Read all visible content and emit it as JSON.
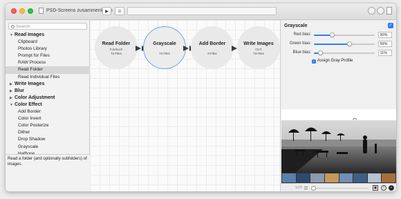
{
  "window": {
    "title": "PSD-Screens zusammenlegen"
  },
  "toolbar": {
    "play_icon": "play-icon",
    "play_glyph": "▶",
    "grid_icon": "grid-icon",
    "grid_glyph": "⊞",
    "search_field_value": "",
    "right_buttons": [
      "circle-button",
      "circle-button",
      "document-icon"
    ]
  },
  "sidebar": {
    "search_placeholder": "Search",
    "tree": [
      {
        "kind": "category",
        "label": "Read Images",
        "expanded": true
      },
      {
        "kind": "item",
        "label": "Clipboard"
      },
      {
        "kind": "item",
        "label": "Photos Library"
      },
      {
        "kind": "item",
        "label": "Prompt for Files"
      },
      {
        "kind": "item",
        "label": "RAW Process"
      },
      {
        "kind": "item",
        "label": "Read Folder",
        "selected": true
      },
      {
        "kind": "item",
        "label": "Read Individual Files"
      },
      {
        "kind": "category",
        "label": "Write Images",
        "expanded": false
      },
      {
        "kind": "category",
        "label": "Blur",
        "expanded": false
      },
      {
        "kind": "category",
        "label": "Color Adjustment",
        "expanded": false
      },
      {
        "kind": "category",
        "label": "Color Effect",
        "expanded": true
      },
      {
        "kind": "item",
        "label": "Add Border"
      },
      {
        "kind": "item",
        "label": "Color Invert"
      },
      {
        "kind": "item",
        "label": "Color Posterize"
      },
      {
        "kind": "item",
        "label": "Dither"
      },
      {
        "kind": "item",
        "label": "Drop Shadow"
      },
      {
        "kind": "item",
        "label": "Grayscale"
      },
      {
        "kind": "item",
        "label": "Halftone"
      }
    ],
    "description": "Read a folder (and optionally subfolders) of images."
  },
  "workflow": {
    "nodes": [
      {
        "title": "Read Folder",
        "subtitle": "Fotobuch",
        "files": "73 Files",
        "selected": false
      },
      {
        "title": "Grayscale",
        "subtitle": "",
        "files": "73 Files",
        "selected": true
      },
      {
        "title": "Add Border",
        "subtitle": "",
        "files": "0 Files",
        "selected": false
      },
      {
        "title": "Write Images",
        "subtitle": "OUT",
        "files": "73 Files",
        "selected": false
      }
    ]
  },
  "inspector": {
    "title": "Grayscale",
    "enabled": true,
    "sliders": [
      {
        "label": "Red bias:",
        "value": "30%",
        "fraction": 0.3
      },
      {
        "label": "Green bias:",
        "value": "59%",
        "fraction": 0.59
      },
      {
        "label": "Blue bias:",
        "value": "11%",
        "fraction": 0.11
      }
    ],
    "assign_gray_profile": {
      "label": "Assign Gray Profile",
      "checked": true
    },
    "bottom": {
      "pager": "1/73",
      "zoom_level": 0.0
    }
  },
  "colors": {
    "accent": "#2f7ef5",
    "selected_node_border": "#6aa3ea",
    "close": "#fe5f57",
    "minimize": "#febc2e",
    "zoom": "#28c840"
  }
}
